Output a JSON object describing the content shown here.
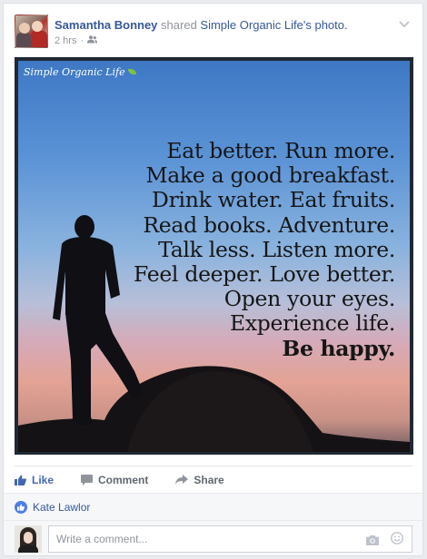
{
  "post": {
    "author": "Samantha Bonney",
    "shared_text": "shared",
    "page_name": "Simple Organic Life",
    "page_suffix": "'s photo.",
    "time": "2 hrs",
    "separator": "·",
    "audience_icon": "friends-icon"
  },
  "photo": {
    "brand": "Simple Organic Life",
    "quote_lines": [
      "Eat better. Run more.",
      "Make a good breakfast.",
      "Drink water. Eat fruits.",
      "Read books. Adventure.",
      "Talk less. Listen more.",
      "Feel deeper. Love better.",
      "Open your eyes.",
      "Experience life."
    ],
    "quote_last": "Be happy."
  },
  "actions": {
    "like": "Like",
    "comment": "Comment",
    "share": "Share"
  },
  "likes": {
    "names": "Kate Lawlor"
  },
  "comment_box": {
    "placeholder": "Write a comment..."
  },
  "colors": {
    "link": "#365899",
    "like_blue": "#4267b2",
    "muted": "#90949c"
  }
}
